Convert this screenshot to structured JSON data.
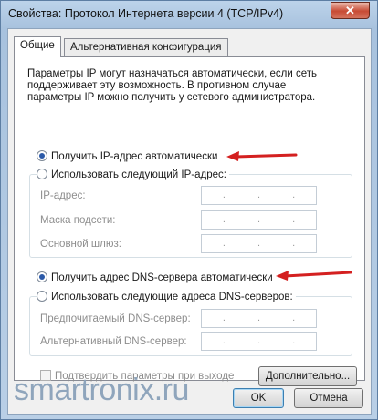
{
  "window": {
    "title": "Свойства: Протокол Интернета версии 4 (TCP/IPv4)",
    "close_glyph": "✕"
  },
  "tabs": [
    {
      "label": "Общие",
      "active": true
    },
    {
      "label": "Альтернативная конфигурация",
      "active": false
    }
  ],
  "intro_text": "Параметры IP могут назначаться автоматически, если сеть поддерживает эту возможность. В противном случае параметры IP можно получить у сетевого администратора.",
  "ip_section": {
    "auto_option": {
      "label": "Получить IP-адрес автоматически",
      "selected": true
    },
    "manual_option": {
      "label": "Использовать следующий IP-адрес:",
      "selected": false
    },
    "fields": [
      {
        "label": "IP-адрес:",
        "value": ". . ."
      },
      {
        "label": "Маска подсети:",
        "value": ". . ."
      },
      {
        "label": "Основной шлюз:",
        "value": ". . ."
      }
    ]
  },
  "dns_section": {
    "auto_option": {
      "label": "Получить адрес DNS-сервера автоматически",
      "selected": true
    },
    "manual_option": {
      "label": "Использовать следующие адреса DNS-серверов:",
      "selected": false
    },
    "fields": [
      {
        "label": "Предпочитаемый DNS-сервер:",
        "value": ". . ."
      },
      {
        "label": "Альтернативный DNS-сервер:",
        "value": ". . ."
      }
    ]
  },
  "validate_checkbox": {
    "label": "Подтвердить параметры при выходе",
    "checked": false
  },
  "buttons": {
    "advanced": "Дополнительно...",
    "ok": "OK",
    "cancel": "Отмена"
  },
  "watermark": "smartronix.ru",
  "colors": {
    "arrow": "#d42020",
    "radio_dot": "#2c5aa8",
    "watermark": "#8aa2ba"
  }
}
